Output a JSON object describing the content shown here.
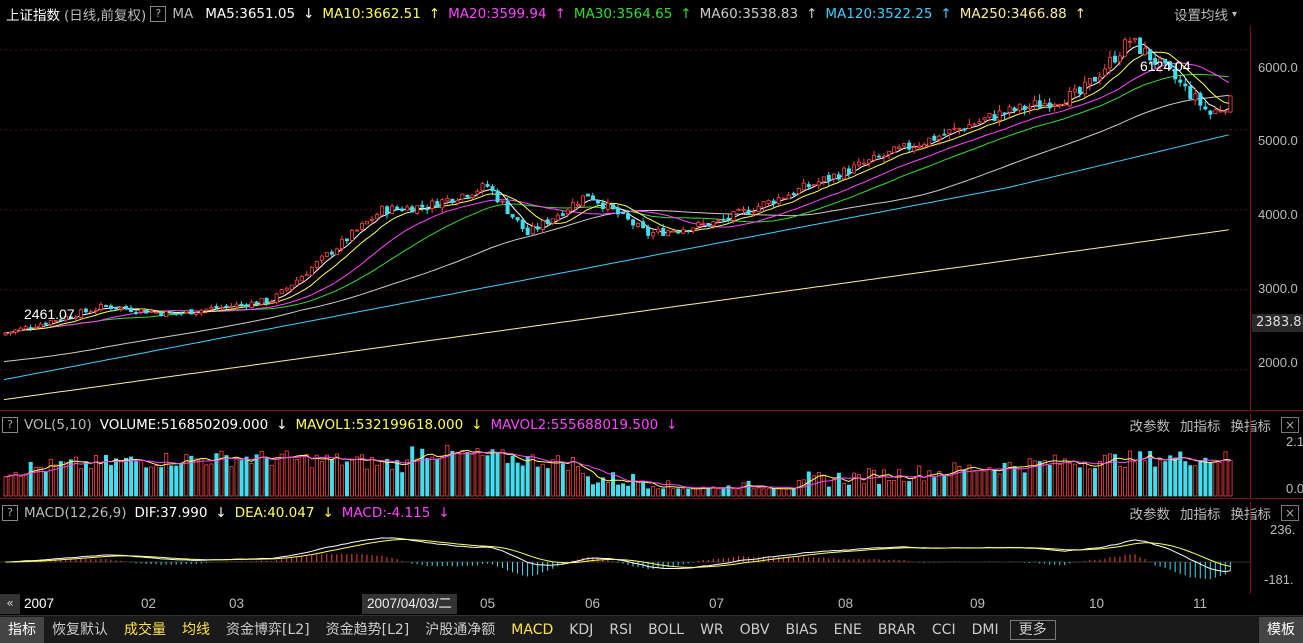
{
  "main": {
    "title": "上证指数",
    "subtitle": "(日线,前复权)",
    "help": "?",
    "ma_label": "MA",
    "indicators": [
      {
        "text": "MA5:3651.05",
        "arrow": "↓",
        "color": "#ffffff"
      },
      {
        "text": "MA10:3662.51",
        "arrow": "↑",
        "color": "#ffff55"
      },
      {
        "text": "MA20:3599.94",
        "arrow": "↑",
        "color": "#ff44ff"
      },
      {
        "text": "MA30:3564.65",
        "arrow": "↑",
        "color": "#33dd33"
      },
      {
        "text": "MA60:3538.83",
        "arrow": "↑",
        "color": "#cccccc"
      },
      {
        "text": "MA120:3522.25",
        "arrow": "↑",
        "color": "#44ccff"
      },
      {
        "text": "MA250:3466.88",
        "arrow": "↑",
        "color": "#ffee99"
      }
    ],
    "settings": "设置均线",
    "high_label": "6124.04",
    "low_label": "2461.07",
    "y_ticks": [
      "6000.0",
      "5000.0",
      "4000.0",
      "3000.0",
      "2000.0"
    ],
    "current_price": "2383.8"
  },
  "volume": {
    "help": "?",
    "name": "VOL(5,10)",
    "indicators": [
      {
        "text": "VOLUME:516850209.000",
        "arrow": "↓",
        "color": "#ffffff"
      },
      {
        "text": "MAVOL1:532199618.000",
        "arrow": "↓",
        "color": "#ffff55"
      },
      {
        "text": "MAVOL2:555688019.500",
        "arrow": "↓",
        "color": "#ff44ff"
      }
    ],
    "btn_params": "改参数",
    "btn_add": "加指标",
    "btn_switch": "换指标",
    "close": "×",
    "y_ticks": [
      "2.1",
      "0.0"
    ]
  },
  "macd": {
    "help": "?",
    "name": "MACD(12,26,9)",
    "indicators": [
      {
        "text": "DIF:37.990",
        "arrow": "↓",
        "color": "#ffffff"
      },
      {
        "text": "DEA:40.047",
        "arrow": "↓",
        "color": "#ffff55"
      },
      {
        "text": "MACD:-4.115",
        "arrow": "↓",
        "color": "#ff44ff"
      }
    ],
    "btn_params": "改参数",
    "btn_add": "加指标",
    "btn_switch": "换指标",
    "close": "×",
    "y_ticks": [
      "236.",
      "-181."
    ]
  },
  "xaxis": {
    "nav": "«",
    "year": "2007",
    "months": [
      "02",
      "03",
      "05",
      "06",
      "07",
      "08",
      "09",
      "10",
      "11"
    ],
    "cursor_date": "2007/04/03/二"
  },
  "tabs": [
    {
      "label": "指标",
      "style": "sel"
    },
    {
      "label": "恢复默认",
      "style": ""
    },
    {
      "label": "成交量",
      "style": "hl"
    },
    {
      "label": "均线",
      "style": "hl"
    },
    {
      "label": "资金博弈[L2]",
      "style": ""
    },
    {
      "label": "资金趋势[L2]",
      "style": ""
    },
    {
      "label": "沪股通净额",
      "style": ""
    },
    {
      "label": "MACD",
      "style": "hl"
    },
    {
      "label": "KDJ",
      "style": ""
    },
    {
      "label": "RSI",
      "style": ""
    },
    {
      "label": "BOLL",
      "style": ""
    },
    {
      "label": "WR",
      "style": ""
    },
    {
      "label": "OBV",
      "style": ""
    },
    {
      "label": "BIAS",
      "style": ""
    },
    {
      "label": "ENE",
      "style": ""
    },
    {
      "label": "BRAR",
      "style": ""
    },
    {
      "label": "CCI",
      "style": ""
    },
    {
      "label": "DMI",
      "style": ""
    },
    {
      "label": "更多",
      "style": "box"
    },
    {
      "label": "模板",
      "style": "sel"
    }
  ],
  "chart_data": {
    "type": "candlestick",
    "y_range": [
      1500,
      6300
    ],
    "price_path": [
      [
        0,
        2461
      ],
      [
        20,
        2800
      ],
      [
        33,
        2700
      ],
      [
        53,
        2870
      ],
      [
        75,
        4000
      ],
      [
        84,
        4050
      ],
      [
        96,
        4300
      ],
      [
        104,
        3700
      ],
      [
        116,
        4200
      ],
      [
        128,
        3700
      ],
      [
        142,
        3850
      ],
      [
        160,
        4300
      ],
      [
        176,
        4700
      ],
      [
        198,
        5200
      ],
      [
        214,
        5450
      ],
      [
        224,
        6124
      ],
      [
        232,
        5700
      ],
      [
        240,
        5200
      ],
      [
        244,
        5350
      ]
    ],
    "ma_colors": {
      "ma5": "#ffffff",
      "ma10": "#ffff55",
      "ma20": "#ff44ff",
      "ma30": "#33dd33",
      "ma60": "#cccccc",
      "ma120": "#44ccff",
      "ma250": "#ffee99"
    }
  }
}
